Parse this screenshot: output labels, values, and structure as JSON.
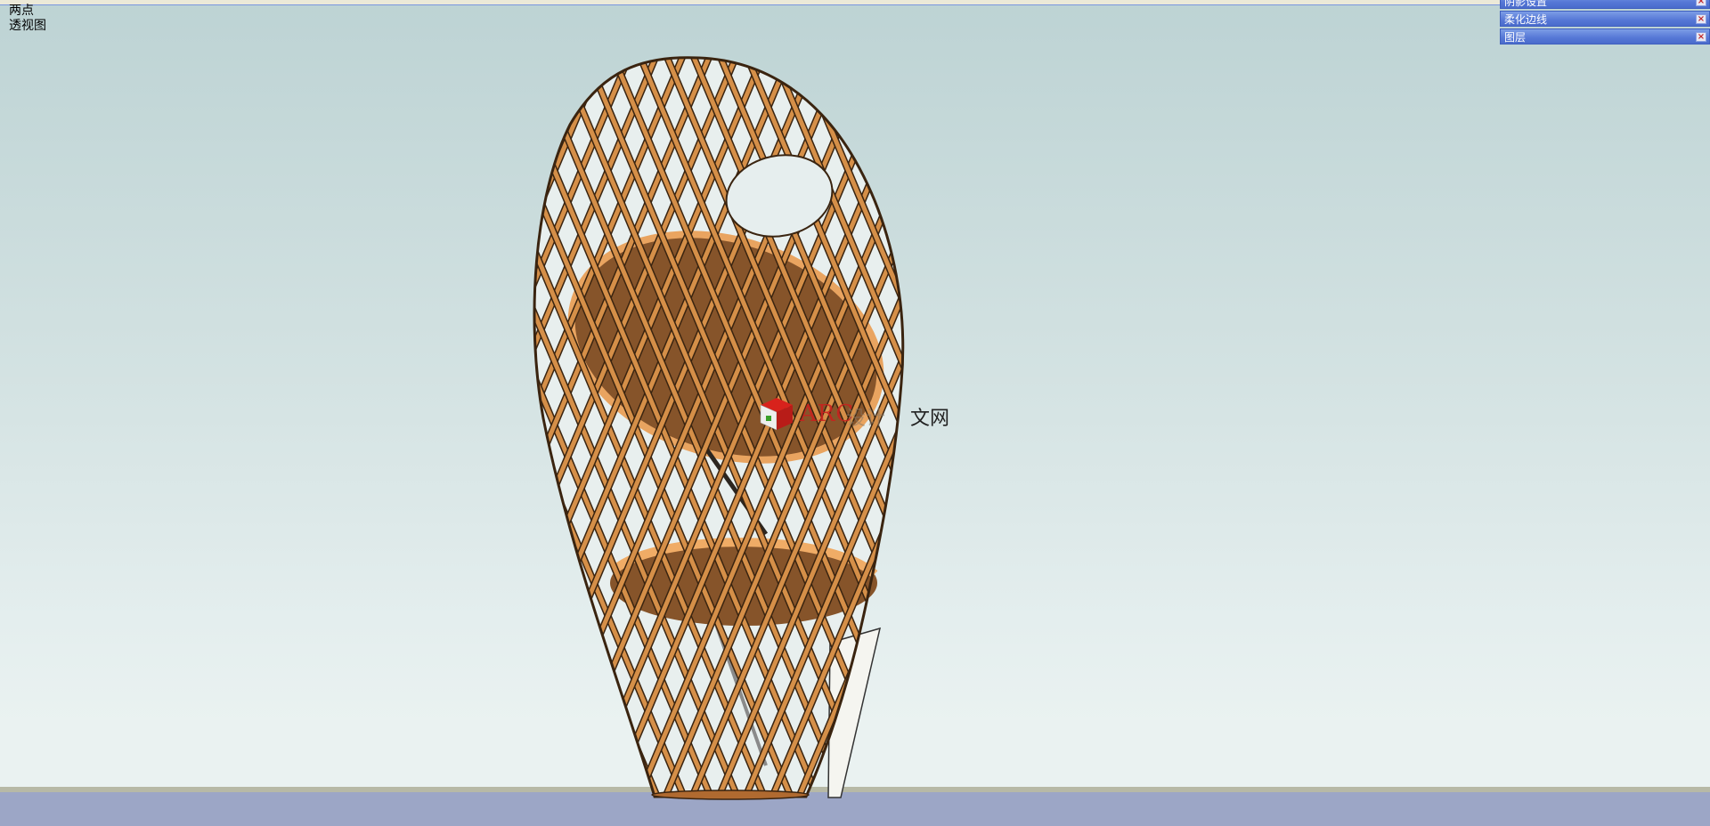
{
  "viewport": {
    "view_mode_line1": "两点",
    "view_mode_line2": "透视图",
    "sky_top_color": "#bdd3d4",
    "sky_bottom_color": "#eaf2f1",
    "ground_color": "#9ca6c6"
  },
  "tray": {
    "items": [
      {
        "label": "阴影设置",
        "close": "×"
      },
      {
        "label": "柔化边线",
        "close": "×"
      },
      {
        "label": "图层",
        "close": "×"
      }
    ]
  },
  "model": {
    "description_icon": "woven-bamboo-pavilion-model",
    "lattice_color": "#d58f48",
    "floor_color": "#86542a",
    "edge_color": "#3a2410"
  },
  "watermark": {
    "red_text": "ARC",
    "mid_text": "设计",
    "tail_text": "文网"
  }
}
